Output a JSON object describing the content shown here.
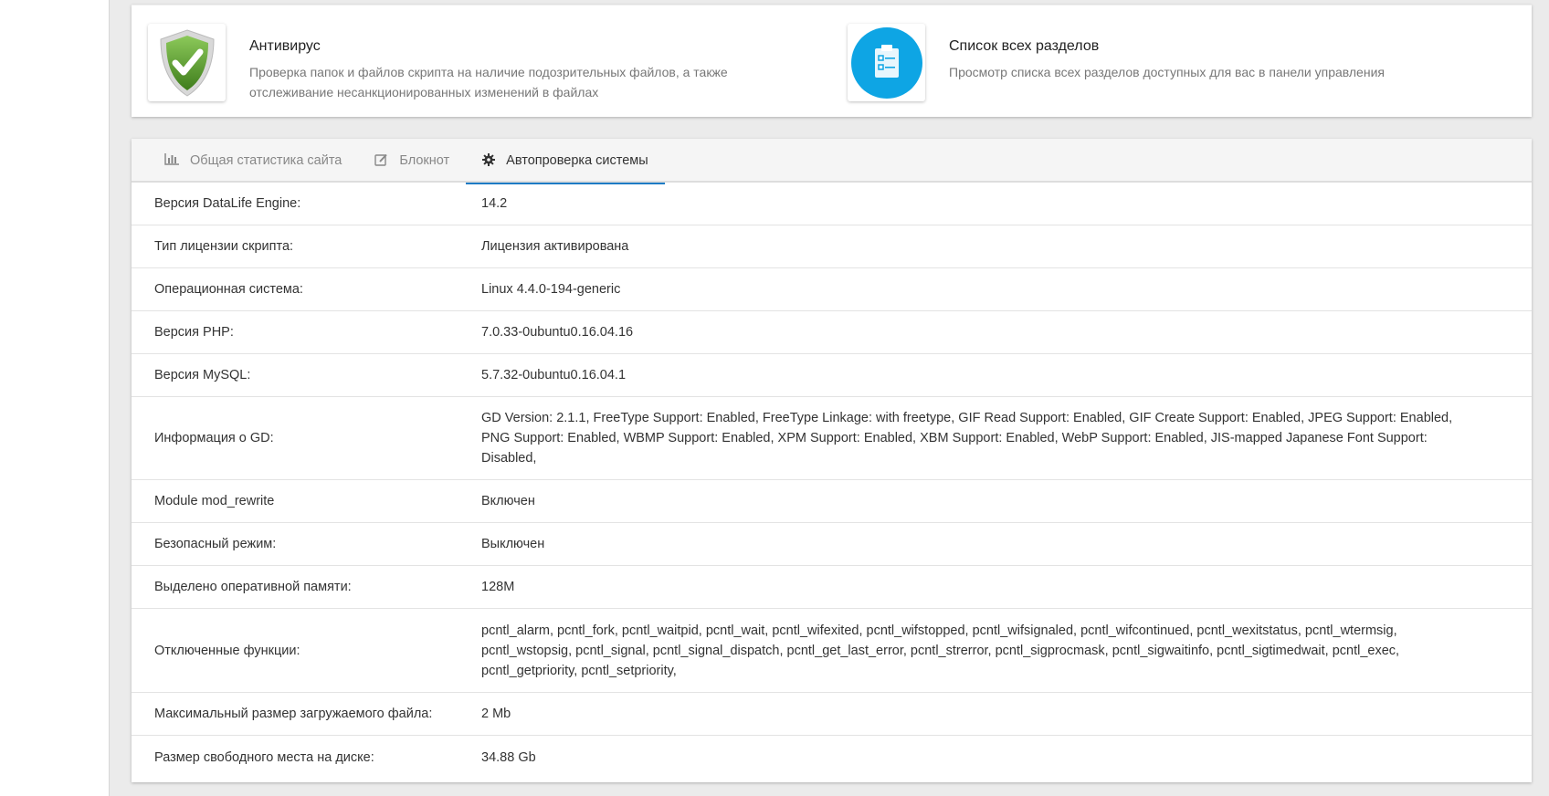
{
  "tiles": [
    {
      "title": "Антивирус",
      "description": "Проверка папок и файлов скрипта на наличие подозрительных файлов, а также отслеживание несанкционированных изменений в файлах",
      "icon": "shield-check-icon"
    },
    {
      "title": "Список всех разделов",
      "description": "Просмотр списка всех разделов доступных для вас в панели управления",
      "icon": "clipboard-list-icon"
    }
  ],
  "tabs": [
    {
      "label": "Общая статистика сайта",
      "icon": "bar-chart-icon",
      "active": false
    },
    {
      "label": "Блокнот",
      "icon": "edit-icon",
      "active": false
    },
    {
      "label": "Автопроверка системы",
      "icon": "gear-icon",
      "active": true
    }
  ],
  "rows": [
    {
      "label": "Версия DataLife Engine:",
      "value": "14.2"
    },
    {
      "label": "Тип лицензии скрипта:",
      "value": "Лицензия активирована"
    },
    {
      "label": "Операционная система:",
      "value": "Linux 4.4.0-194-generic"
    },
    {
      "label": "Версия PHP:",
      "value": "7.0.33-0ubuntu0.16.04.16"
    },
    {
      "label": "Версия MySQL:",
      "value": "5.7.32-0ubuntu0.16.04.1"
    },
    {
      "label": "Информация о GD:",
      "value": "GD Version: 2.1.1, FreeType Support: Enabled, FreeType Linkage: with freetype, GIF Read Support: Enabled, GIF Create Support: Enabled, JPEG Support: Enabled, PNG Support: Enabled, WBMP Support: Enabled, XPM Support: Enabled, XBM Support: Enabled, WebP Support: Enabled, JIS-mapped Japanese Font Support: Disabled,"
    },
    {
      "label": "Module mod_rewrite",
      "value": "Включен"
    },
    {
      "label": "Безопасный режим:",
      "value": "Выключен"
    },
    {
      "label": "Выделено оперативной памяти:",
      "value": "128M"
    },
    {
      "label": "Отключенные функции:",
      "value": "pcntl_alarm, pcntl_fork, pcntl_waitpid, pcntl_wait, pcntl_wifexited, pcntl_wifstopped, pcntl_wifsignaled, pcntl_wifcontinued, pcntl_wexitstatus, pcntl_wtermsig, pcntl_wstopsig, pcntl_signal, pcntl_signal_dispatch, pcntl_get_last_error, pcntl_strerror, pcntl_sigprocmask, pcntl_sigwaitinfo, pcntl_sigtimedwait, pcntl_exec, pcntl_getpriority, pcntl_setpriority,"
    },
    {
      "label": "Максимальный размер загружаемого файла:",
      "value": "2 Mb"
    },
    {
      "label": "Размер свободного места на диске:",
      "value": "34.88 Gb"
    }
  ],
  "colors": {
    "accent": "#1e7bc4",
    "shield": "#5a9e2f",
    "list_icon": "#0ea5e4"
  }
}
